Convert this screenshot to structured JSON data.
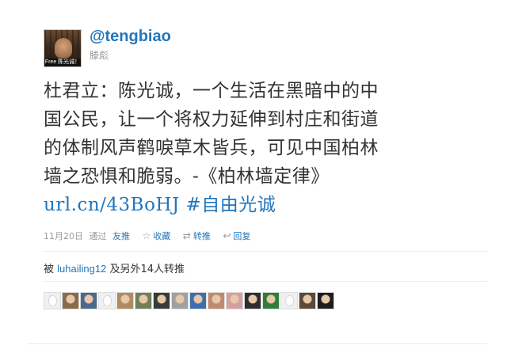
{
  "tweet": {
    "avatar_caption": "Free 陈光诚！",
    "handle": "@tengbiao",
    "display_name": "滕彪",
    "text_lines": [
      "杜君立：陈光诚，一个生活在黑暗中的中",
      "国公民，让一个将权力延伸到村庄和街道",
      "的体制风声鹤唳草木皆兵，可见中国柏林",
      "墙之恐惧和脆弱。-《柏林墙定律》"
    ],
    "link": "url.cn/43BoHJ",
    "hashtag": "#自由光诚",
    "meta": {
      "date": "11月20日",
      "via": "通过",
      "source": "友推",
      "favorite_label": "收藏",
      "retweet_label": "转推",
      "reply_label": "回复"
    },
    "retweeted_by": {
      "prefix": "被",
      "user": "luhailing12",
      "middle": "及另外",
      "count": "14",
      "suffix": "人转推"
    },
    "retweeter_avatars": [
      {
        "kind": "egg"
      },
      {
        "kind": "photo",
        "color": "#8a6b4a"
      },
      {
        "kind": "photo",
        "color": "#4a6a8c"
      },
      {
        "kind": "egg"
      },
      {
        "kind": "photo",
        "color": "#b08a60"
      },
      {
        "kind": "photo",
        "color": "#6f7f5a"
      },
      {
        "kind": "photo",
        "color": "#3a3a3a"
      },
      {
        "kind": "photo",
        "color": "#a0a0a0"
      },
      {
        "kind": "photo",
        "color": "#3d6fb0"
      },
      {
        "kind": "photo",
        "color": "#c08a70"
      },
      {
        "kind": "photo",
        "color": "#d2a0a0"
      },
      {
        "kind": "photo",
        "color": "#2d2d2d"
      },
      {
        "kind": "photo",
        "color": "#2e7d3a"
      },
      {
        "kind": "egg"
      },
      {
        "kind": "photo",
        "color": "#5a4a3a"
      },
      {
        "kind": "photo",
        "color": "#1e1e1e"
      }
    ]
  }
}
